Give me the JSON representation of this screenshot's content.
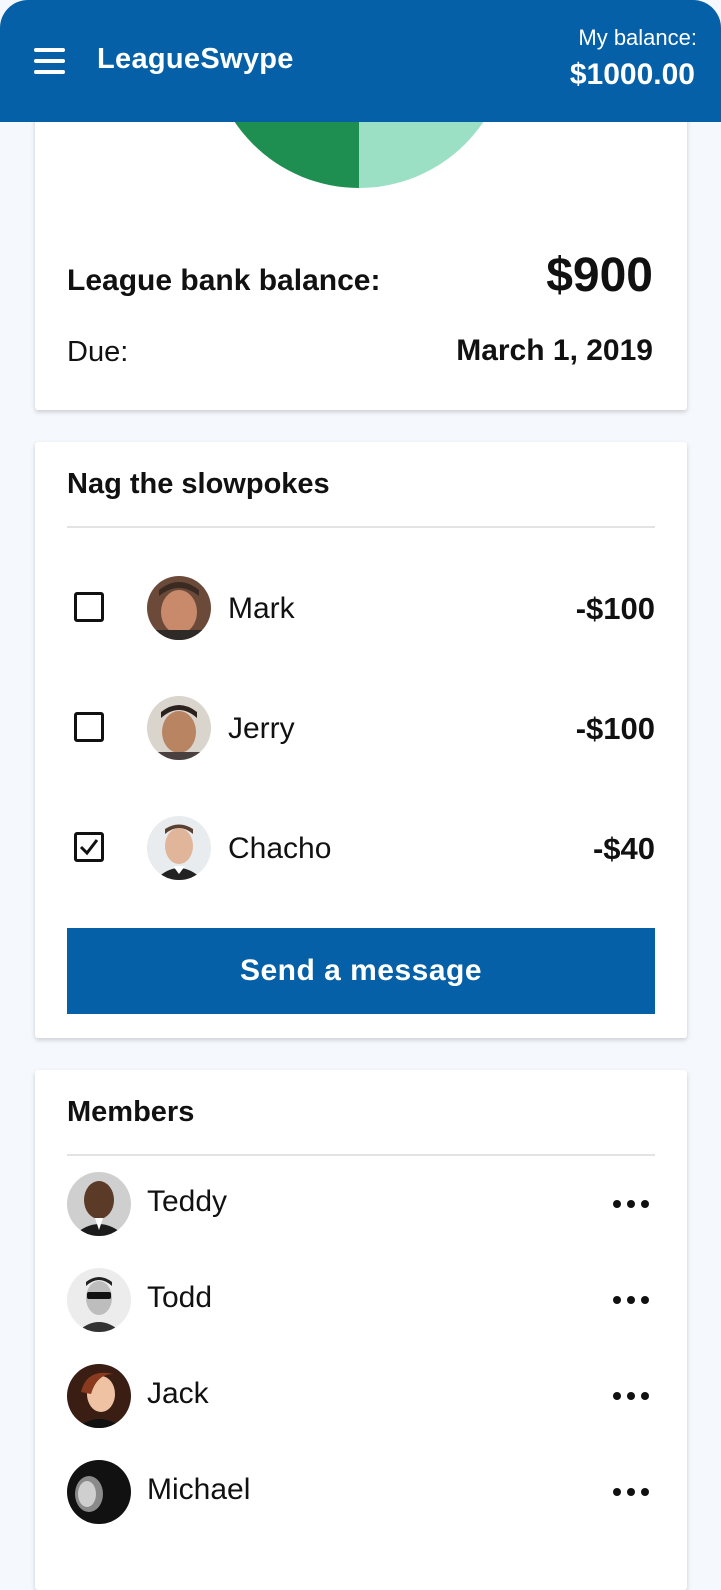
{
  "header": {
    "menu_icon": "hamburger-icon",
    "app_name": "LeagueSwype",
    "balance_label": "My balance:",
    "balance_value": "$1000.00"
  },
  "colors": {
    "brand": "#0560a7",
    "pie_dark": "#1e8f51",
    "pie_light": "#9be0c5"
  },
  "summary": {
    "bank_label": "League bank balance:",
    "bank_value": "$900",
    "due_label": "Due:",
    "due_value": "March 1, 2019"
  },
  "nag": {
    "title": "Nag the slowpokes",
    "rows": [
      {
        "name": "Mark",
        "amount": "-$100",
        "checked": false
      },
      {
        "name": "Jerry",
        "amount": "-$100",
        "checked": false
      },
      {
        "name": "Chacho",
        "amount": "-$40",
        "checked": true
      }
    ],
    "send_label": "Send a message"
  },
  "members": {
    "title": "Members",
    "items": [
      {
        "name": "Teddy",
        "more_icon": "more-horizontal-icon"
      },
      {
        "name": "Todd",
        "more_icon": "more-horizontal-icon"
      },
      {
        "name": "Jack",
        "more_icon": "more-horizontal-icon"
      },
      {
        "name": "Michael",
        "more_icon": "more-horizontal-icon"
      }
    ]
  }
}
